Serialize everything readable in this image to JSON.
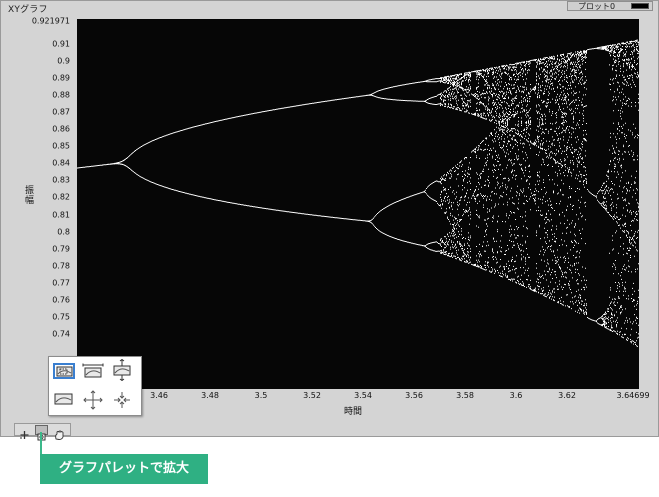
{
  "window": {
    "title": "XYグラフ"
  },
  "legend": {
    "label": "プロット0"
  },
  "graph": {
    "y_ticks": [
      "0.921971",
      "0.91",
      "0.9",
      "0.89",
      "0.88",
      "0.87",
      "0.86",
      "0.85",
      "0.84",
      "0.83",
      "0.82",
      "0.81",
      "0.8",
      "0.79",
      "0.78",
      "0.77",
      "0.76",
      "0.75",
      "0.74",
      "0.7"
    ],
    "x_ticks": [
      "3.46",
      "3.48",
      "3.5",
      "3.52",
      "3.54",
      "3.56",
      "3.58",
      "3.6",
      "3.62",
      "3.64699"
    ],
    "x_label": "時間",
    "y_label": "振幅",
    "background": "#060606",
    "dot_color": "#ffffff"
  },
  "palette": {
    "tools": [
      "rect-zoom-icon",
      "x-zoom-icon",
      "y-zoom-icon",
      "fit-zoom-icon",
      "zoom-in-icon",
      "zoom-out-icon"
    ],
    "selected": "rect-zoom-icon",
    "accent": "#3a7fd0"
  },
  "bottom_tools": [
    "cursor-move-icon",
    "zoom-icon",
    "pan-hand-icon"
  ],
  "callout": {
    "text": "グラフパレットで拡大",
    "color": "#2fb083"
  }
}
